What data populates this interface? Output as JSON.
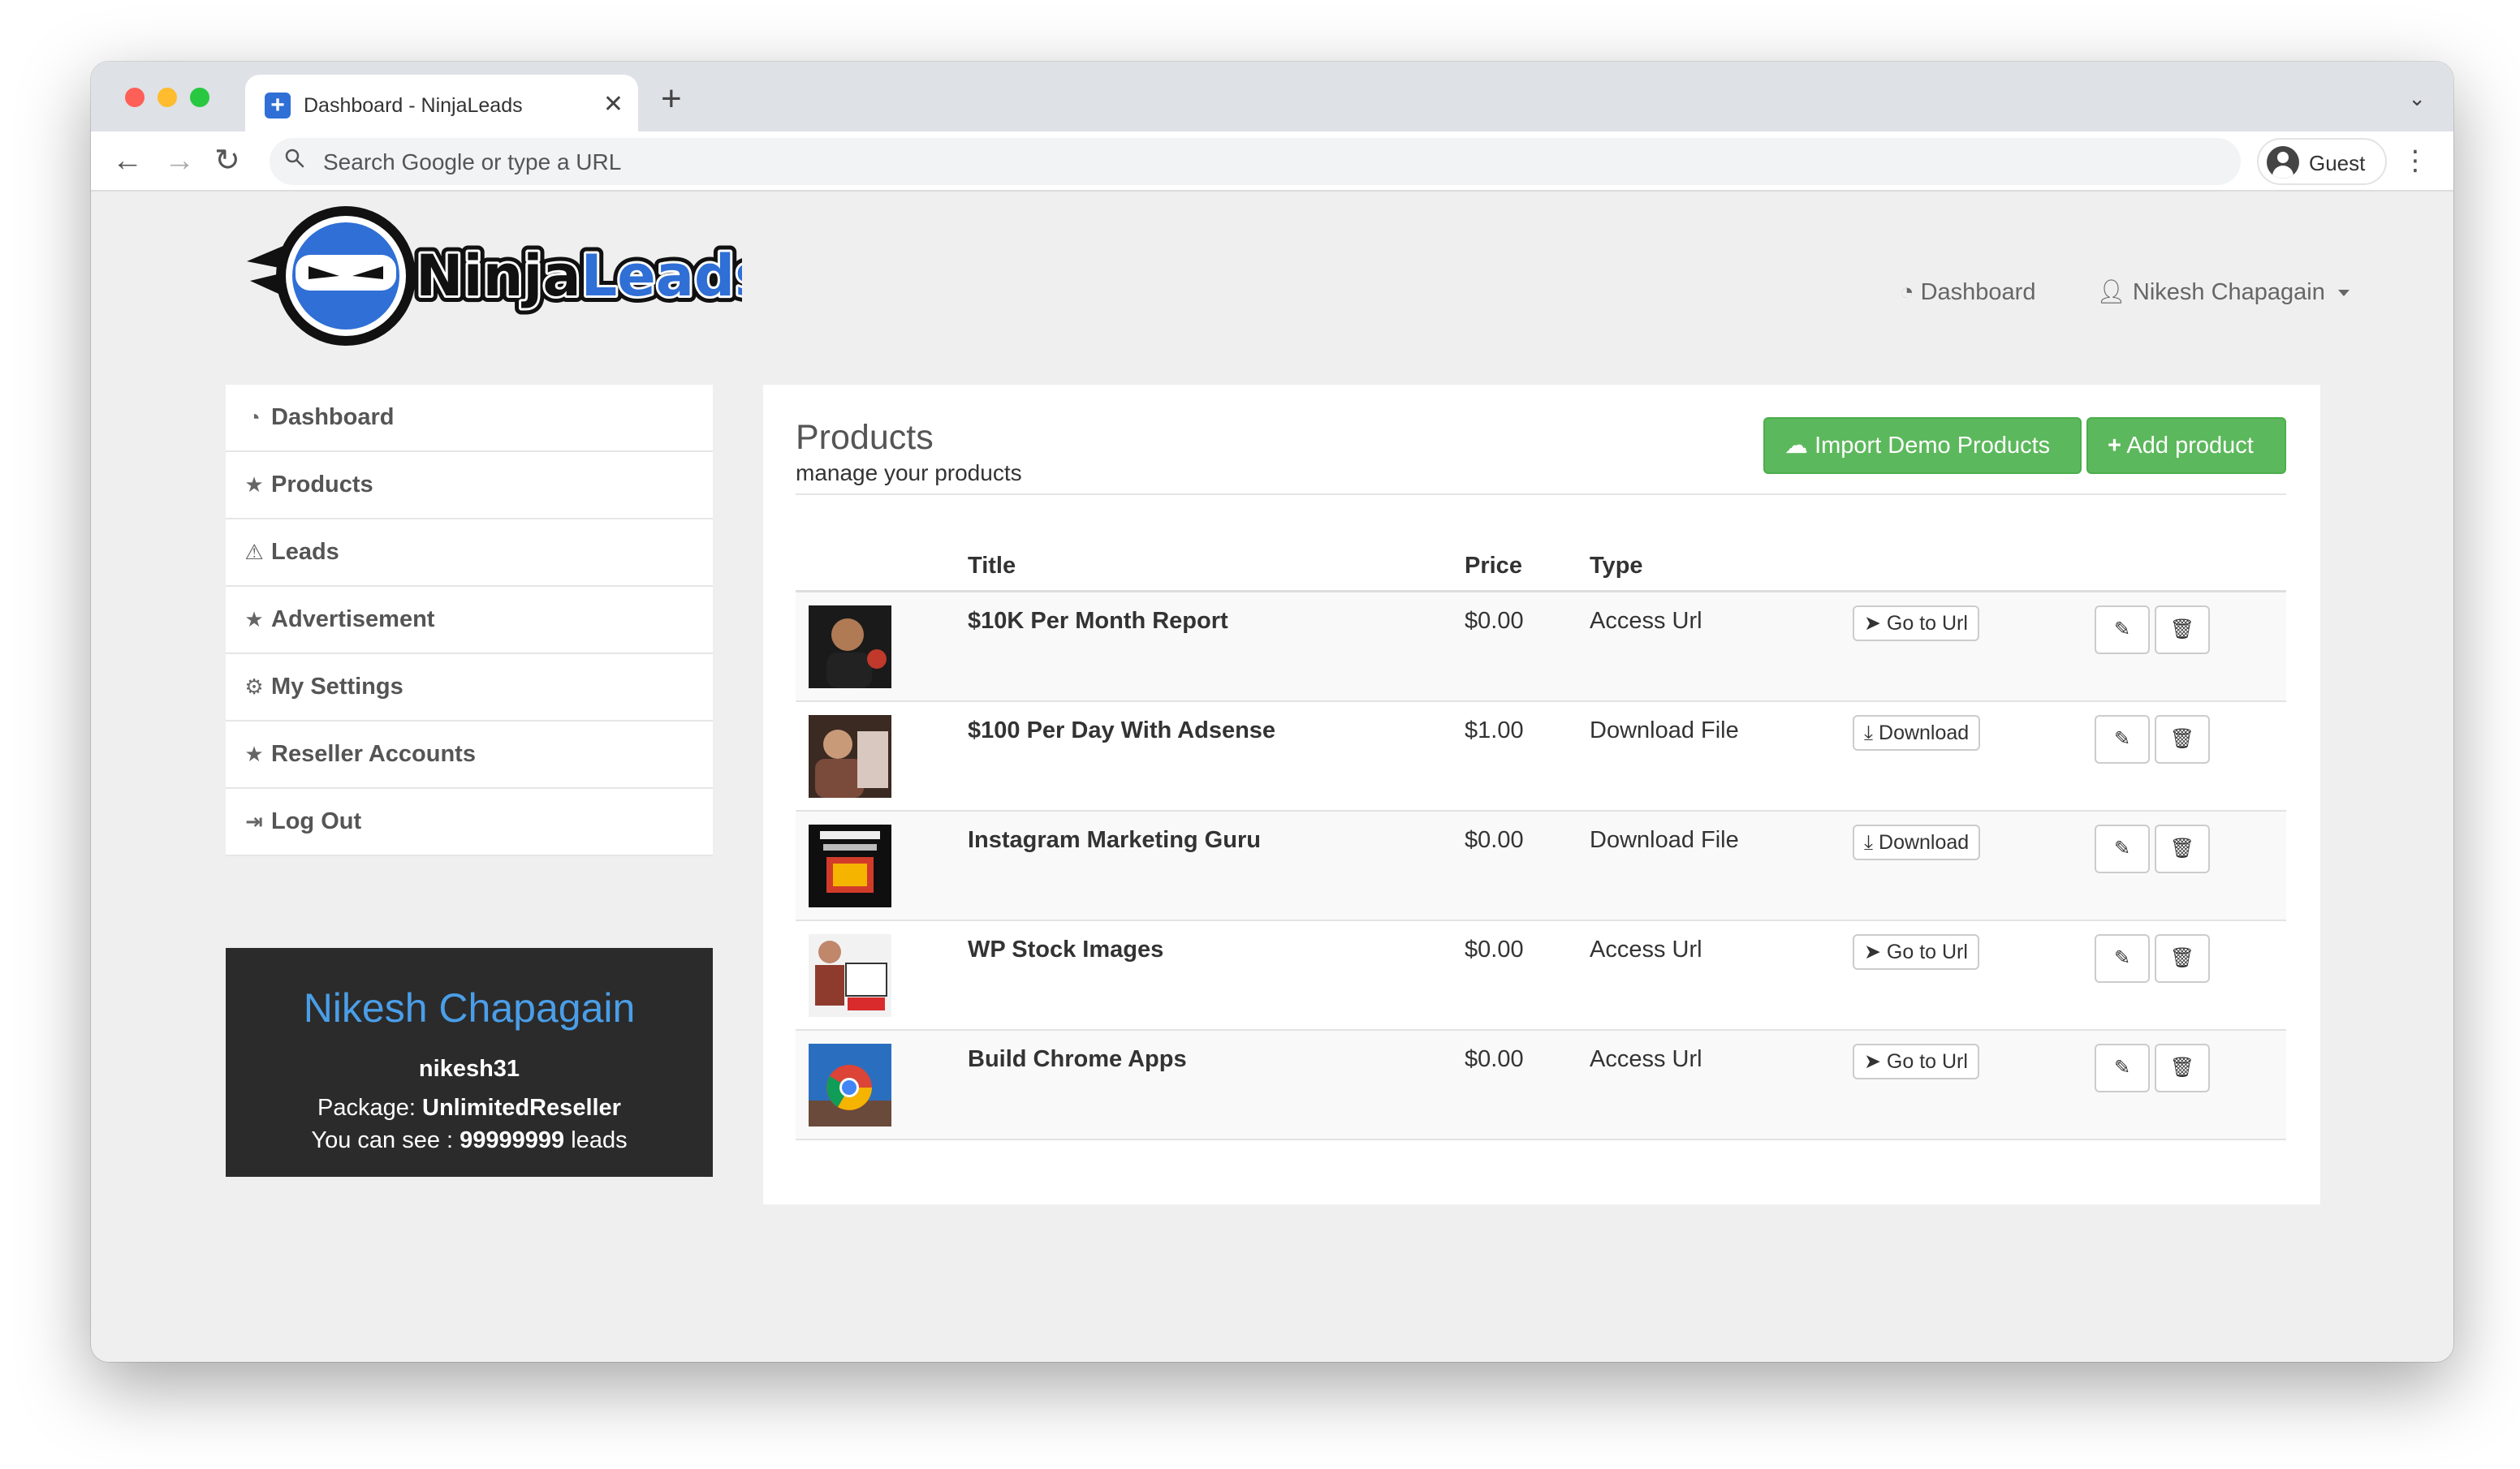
{
  "browser": {
    "tab_title": "Dashboard - NinjaLeads",
    "new_tab": "+",
    "close": "✕",
    "omnibox_placeholder": "Search Google or type a URL",
    "profile_label": "Guest"
  },
  "header": {
    "logo_text": "NinjaLeads",
    "nav_dashboard": "Dashboard",
    "nav_user": "Nikesh Chapagain"
  },
  "sidebar": {
    "items": [
      {
        "label": "Dashboard",
        "icon": "dashboard-icon"
      },
      {
        "label": "Products",
        "icon": "star-icon"
      },
      {
        "label": "Leads",
        "icon": "warning-icon"
      },
      {
        "label": "Advertisement",
        "icon": "star-icon"
      },
      {
        "label": "My Settings",
        "icon": "gears-icon"
      },
      {
        "label": "Reseller Accounts",
        "icon": "star-icon"
      },
      {
        "label": "Log Out",
        "icon": "logout-icon"
      }
    ]
  },
  "profile": {
    "name": "Nikesh Chapagain",
    "username": "nikesh31",
    "package_label": "Package: ",
    "package_value": "UnlimitedReseller",
    "leads_label": "You can see : ",
    "leads_value": "99999999",
    "leads_suffix": " leads"
  },
  "content": {
    "title": "Products",
    "subtitle": "manage your products",
    "import_button": "Import Demo Products",
    "add_button": "Add product",
    "columns": {
      "title": "Title",
      "price": "Price",
      "type": "Type"
    },
    "products": [
      {
        "title": "$10K Per Month Report",
        "price": "$0.00",
        "type": "Access Url",
        "action": "Go to Url",
        "action_icon": "send-icon"
      },
      {
        "title": "$100 Per Day With Adsense",
        "price": "$1.00",
        "type": "Download File",
        "action": "Download",
        "action_icon": "download-icon"
      },
      {
        "title": "Instagram Marketing Guru",
        "price": "$0.00",
        "type": "Download File",
        "action": "Download",
        "action_icon": "download-icon"
      },
      {
        "title": "WP Stock Images",
        "price": "$0.00",
        "type": "Access Url",
        "action": "Go to Url",
        "action_icon": "send-icon"
      },
      {
        "title": "Build Chrome Apps",
        "price": "$0.00",
        "type": "Access Url",
        "action": "Go to Url",
        "action_icon": "send-icon"
      }
    ]
  },
  "colors": {
    "accent_green": "#5cb85c",
    "profile_name_blue": "#4a9ee8",
    "profile_bg": "#2b2b2b",
    "logo_blue": "#2f6fd6"
  }
}
